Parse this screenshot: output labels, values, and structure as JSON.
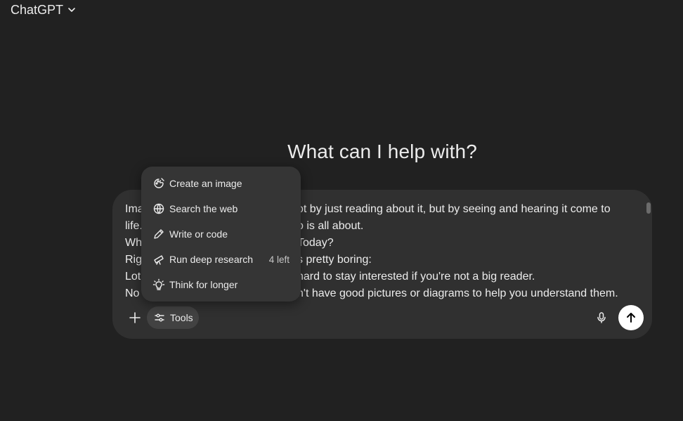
{
  "header": {
    "model_name": "ChatGPT"
  },
  "main": {
    "headline": "What can I help with?"
  },
  "composer": {
    "lines": [
      "Ima",
      "life.",
      "Wh",
      "Rig",
      "Lot",
      "No"
    ],
    "lines_right": [
      "ot by just reading about it, but by seeing and hearing it come to",
      "o is all about.",
      "Today?",
      "s pretty boring:",
      "hard to stay interested if you're not a big reader.",
      "n't have good pictures or diagrams to help you understand them."
    ],
    "tools_label": "Tools",
    "icons": {
      "plus": "plus-icon",
      "tools": "sliders-icon",
      "mic": "microphone-icon",
      "send": "arrow-up-icon"
    }
  },
  "tools_menu": {
    "items": [
      {
        "label": "Create an image",
        "icon": "image-palette-icon"
      },
      {
        "label": "Search the web",
        "icon": "globe-icon"
      },
      {
        "label": "Write or code",
        "icon": "pen-icon"
      },
      {
        "label": "Run deep research",
        "icon": "telescope-icon",
        "badge": "4 left"
      },
      {
        "label": "Think for longer",
        "icon": "lightbulb-icon"
      }
    ]
  },
  "colors": {
    "background": "#212121",
    "composer": "#303030",
    "menu": "#353535",
    "text": "#ececec"
  }
}
